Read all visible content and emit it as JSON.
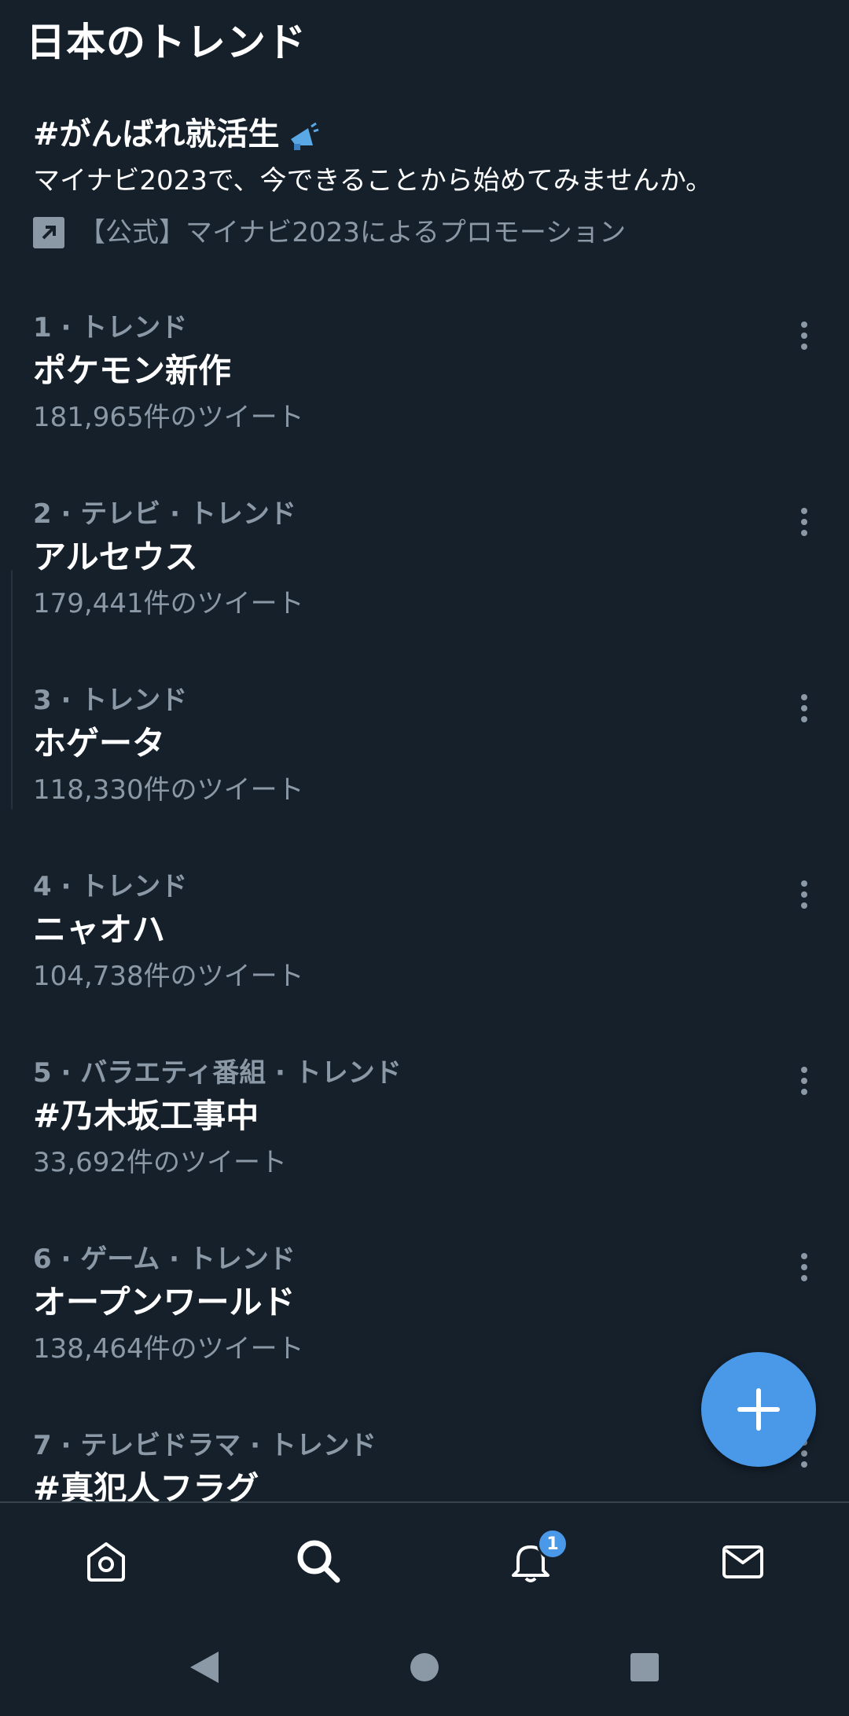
{
  "header": {
    "title": "日本のトレンド"
  },
  "promo": {
    "title": "#がんばれ就活生",
    "description": "マイナビ2023で、今できることから始めてみませんか。",
    "promoted_by": "【公式】マイナビ2023によるプロモーション"
  },
  "trends": [
    {
      "meta": "1 · トレンド",
      "name": "ポケモン新作",
      "count": "181,965件のツイート"
    },
    {
      "meta": "2 · テレビ · トレンド",
      "name": "アルセウス",
      "count": "179,441件のツイート"
    },
    {
      "meta": "3 · トレンド",
      "name": "ホゲータ",
      "count": "118,330件のツイート"
    },
    {
      "meta": "4 · トレンド",
      "name": "ニャオハ",
      "count": "104,738件のツイート"
    },
    {
      "meta": "5 · バラエティ番組 · トレンド",
      "name": "#乃木坂工事中",
      "count": "33,692件のツイート"
    },
    {
      "meta": "6 · ゲーム · トレンド",
      "name": "オープンワールド",
      "count": "138,464件のツイート"
    },
    {
      "meta": "7 · テレビドラマ · トレンド",
      "name": "#真犯人フラグ",
      "count": ""
    }
  ],
  "bottom_nav": {
    "items": [
      "home-icon",
      "search-icon",
      "notifications-icon",
      "messages-icon"
    ],
    "notification_count": "1"
  },
  "colors": {
    "background": "#15202b",
    "accent": "#4a99e9",
    "secondary_text": "#8b98a5"
  }
}
